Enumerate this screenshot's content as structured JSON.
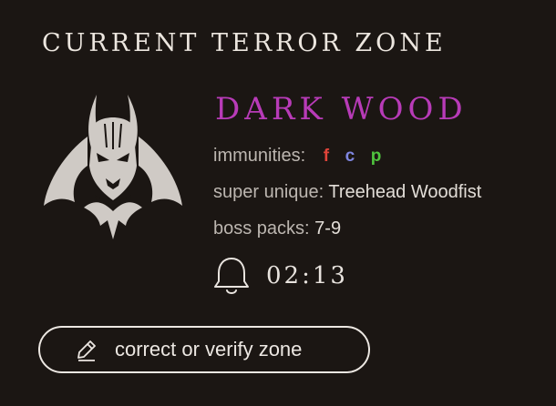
{
  "header": {
    "title": "CURRENT TERROR ZONE"
  },
  "zone": {
    "emblem_icon": "demon-head-icon",
    "name": "DARK WOOD",
    "name_color": "#b83bb8",
    "immunities_label": "immunities:",
    "immunities": [
      {
        "code": "f",
        "color": "#e0443a"
      },
      {
        "code": "c",
        "color": "#7f86e0"
      },
      {
        "code": "p",
        "color": "#4fc33e"
      }
    ],
    "super_unique_label": "super unique:",
    "super_unique_value": "Treehead Woodfist",
    "boss_packs_label": "boss packs:",
    "boss_packs_value": "7-9"
  },
  "timer": {
    "icon": "bell-icon",
    "value": "02:13"
  },
  "actions": {
    "verify_label": "correct or verify zone",
    "verify_icon": "pencil-icon"
  }
}
